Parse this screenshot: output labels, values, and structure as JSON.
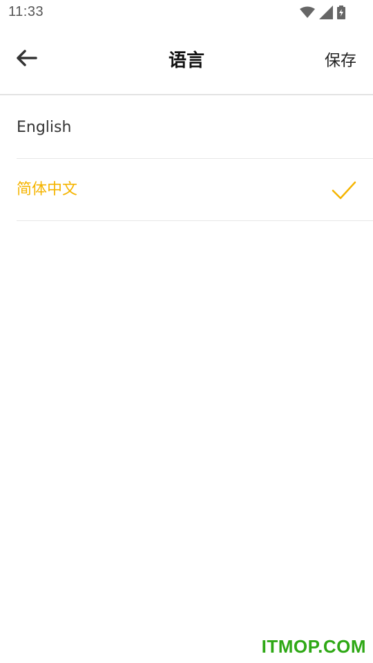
{
  "status_bar": {
    "time": "11:33",
    "icons": [
      "wifi-icon",
      "cell-signal-icon",
      "battery-charging-icon"
    ]
  },
  "toolbar": {
    "back_icon": "arrow-left-icon",
    "title": "语言",
    "save_label": "保存"
  },
  "languages": [
    {
      "label": "English",
      "selected": false
    },
    {
      "label": "简体中文",
      "selected": true
    }
  ],
  "selected_icon": "checkmark-icon",
  "colors": {
    "accent": "#f5b400",
    "divider": "#e6e6e6",
    "text": "#333333"
  },
  "watermark": "ITMOP.COM"
}
